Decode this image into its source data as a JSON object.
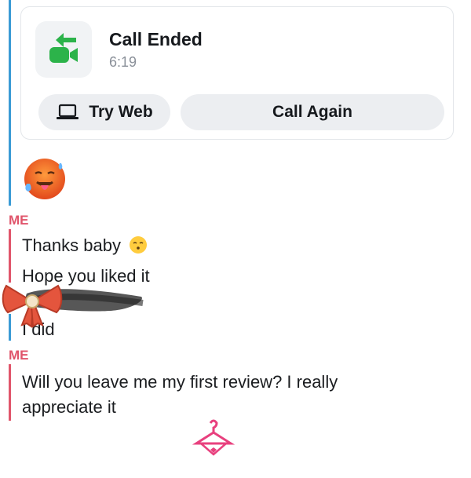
{
  "call": {
    "title": "Call Ended",
    "duration": "6:19",
    "try_web_label": "Try Web",
    "call_again_label": "Call Again",
    "icon": "video-call-ended-icon",
    "accent": "#2cb34a"
  },
  "chat": {
    "reaction_emoji": "hot-face-emoji",
    "groups": [
      {
        "sender": "ME",
        "messages": [
          "Thanks baby",
          "Hope you liked it"
        ]
      },
      {
        "sender": "",
        "messages": [
          "I did"
        ]
      },
      {
        "sender": "ME",
        "messages": [
          "Will you leave me my first review? I really",
          "appreciate it"
        ]
      }
    ]
  },
  "decorations": [
    "bow-sticker",
    "hanger-sticker",
    "kissing-emoji"
  ],
  "colors": {
    "me_bar": "#e0556b",
    "friend_bar": "#3a9bd5",
    "button_bg": "#eceef1"
  }
}
